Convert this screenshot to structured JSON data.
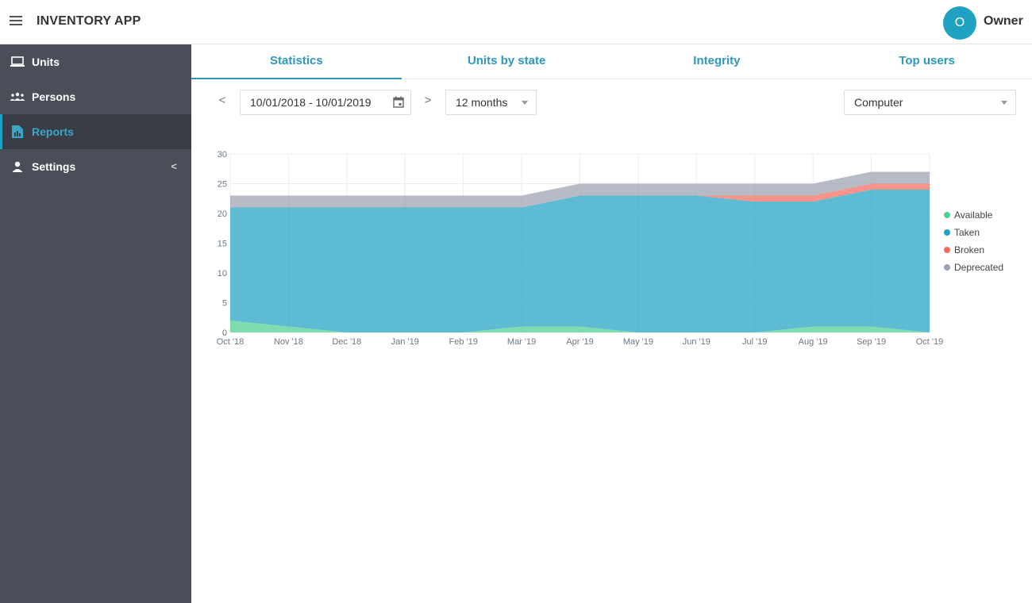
{
  "header": {
    "app_title": "INVENTORY APP",
    "user_initial": "O",
    "user_name": "Owner",
    "accent_color": "#1fa1c2"
  },
  "sidebar": {
    "items": [
      {
        "label": "Units",
        "icon": "laptop-icon",
        "active": false
      },
      {
        "label": "Persons",
        "icon": "people-icon",
        "active": false
      },
      {
        "label": "Reports",
        "icon": "report-icon",
        "active": true
      },
      {
        "label": "Settings",
        "icon": "person-icon",
        "active": false,
        "chevron": "<"
      }
    ]
  },
  "tabs": [
    {
      "label": "Statistics",
      "active": true
    },
    {
      "label": "Units by state",
      "active": false
    },
    {
      "label": "Integrity",
      "active": false
    },
    {
      "label": "Top users",
      "active": false
    }
  ],
  "filters": {
    "prev_label": "<",
    "next_label": ">",
    "date_range": "10/01/2018 - 10/01/2019",
    "period": "12 months",
    "category": "Computer"
  },
  "chart_data": {
    "type": "area",
    "stacked": true,
    "x": [
      "Oct '18",
      "Nov '18",
      "Dec '18",
      "Jan '19",
      "Feb '19",
      "Mar '19",
      "Apr '19",
      "May '19",
      "Jun '19",
      "Jul '19",
      "Aug '19",
      "Sep '19",
      "Oct '19"
    ],
    "yticks": [
      0,
      5,
      10,
      15,
      20,
      25,
      30
    ],
    "ylim": [
      0,
      30
    ],
    "grid": true,
    "legend_position": "right",
    "series": [
      {
        "name": "Available",
        "color": "#4fcf8f",
        "values": [
          2,
          1,
          0,
          0,
          0,
          1,
          1,
          0,
          0,
          0,
          1,
          1,
          0
        ]
      },
      {
        "name": "Taken",
        "color": "#1fa1c2",
        "values": [
          19,
          20,
          21,
          21,
          21,
          20,
          22,
          23,
          23,
          22,
          21,
          23,
          24
        ]
      },
      {
        "name": "Broken",
        "color": "#f56b5b",
        "values": [
          0,
          0,
          0,
          0,
          0,
          0,
          0,
          0,
          0,
          1,
          1,
          1,
          1
        ]
      },
      {
        "name": "Deprecated",
        "color": "#9aa1b0",
        "values": [
          2,
          2,
          2,
          2,
          2,
          2,
          2,
          2,
          2,
          2,
          2,
          2,
          2
        ]
      }
    ]
  }
}
